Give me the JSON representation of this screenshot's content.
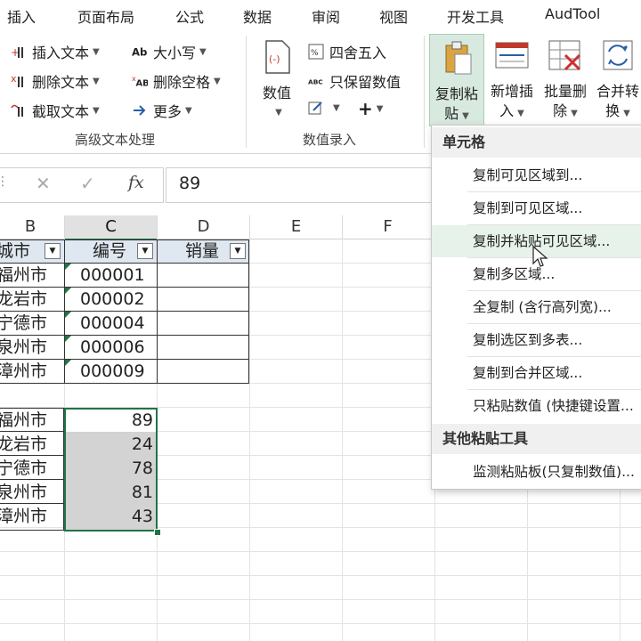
{
  "tabs": [
    "插入",
    "页面布局",
    "公式",
    "数据",
    "审阅",
    "视图",
    "开发工具",
    "AudTool"
  ],
  "ribbon": {
    "text_group": {
      "items": [
        "插入文本",
        "删除文本",
        "截取文本",
        "大小写",
        "删除空格",
        "更多"
      ],
      "label": "高级文本处理"
    },
    "number_group": {
      "big_button": "数值",
      "items": [
        "四舍五入",
        "只保留数值"
      ],
      "plus": "+",
      "label": "数值录入"
    },
    "big_buttons": [
      {
        "line1": "复制粘",
        "line2": "贴"
      },
      {
        "line1": "新增插",
        "line2": "入"
      },
      {
        "line1": "批量删",
        "line2": "除"
      },
      {
        "line1": "合并转",
        "line2": "换"
      }
    ]
  },
  "formula_bar": {
    "cancel": "✕",
    "confirm": "✓",
    "fx": "fx",
    "value": "89"
  },
  "columns": [
    "B",
    "C",
    "D",
    "E",
    "F"
  ],
  "table1": {
    "headers": [
      "城市",
      "编号",
      "销量"
    ],
    "rows": [
      {
        "city": "福州市",
        "code": "000001"
      },
      {
        "city": "龙岩市",
        "code": "000002"
      },
      {
        "city": "宁德市",
        "code": "000004"
      },
      {
        "city": "泉州市",
        "code": "000006"
      },
      {
        "city": "漳州市",
        "code": "000009"
      }
    ]
  },
  "table2": {
    "rows": [
      {
        "city": "福州市",
        "value": "89"
      },
      {
        "city": "龙岩市",
        "value": "24"
      },
      {
        "city": "宁德市",
        "value": "78"
      },
      {
        "city": "泉州市",
        "value": "81"
      },
      {
        "city": "漳州市",
        "value": "43"
      }
    ]
  },
  "menu": {
    "section1": "单元格",
    "items1": [
      "复制可见区域到...",
      "复制到可见区域...",
      "复制并粘贴可见区域...",
      "复制多区域...",
      "全复制 (含行高列宽)...",
      "复制选区到多表...",
      "复制到合并区域...",
      "只粘贴数值 (快捷键设置..."
    ],
    "section2": "其他粘贴工具",
    "items2": [
      "监测粘贴板(只复制数值)..."
    ]
  },
  "colors": {
    "accent": "#217346",
    "selection_fill": "#d3d3d3",
    "menu_highlight": "#e6f2ea"
  }
}
